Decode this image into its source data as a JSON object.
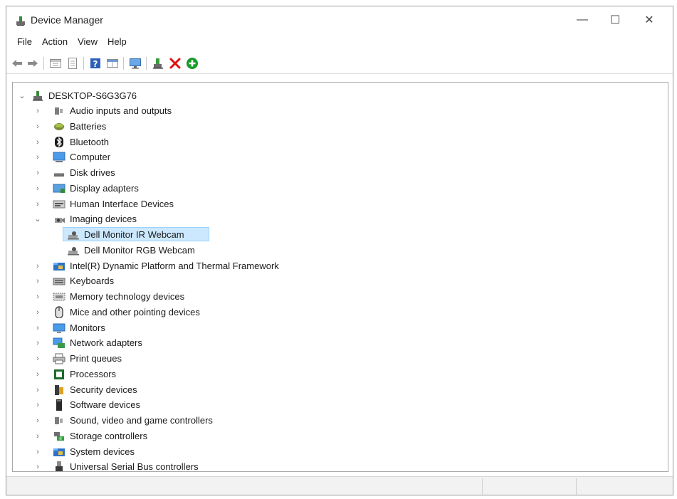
{
  "window": {
    "title": "Device Manager",
    "controls": {
      "minimize": "—",
      "maximize": "☐",
      "close": "✕"
    }
  },
  "menu": [
    "File",
    "Action",
    "View",
    "Help"
  ],
  "toolbar": [
    {
      "name": "back-arrow-icon"
    },
    {
      "name": "forward-arrow-icon"
    },
    {
      "name": "properties-pane-icon"
    },
    {
      "name": "device-sheet-icon"
    },
    {
      "name": "help-icon"
    },
    {
      "name": "view-pane-icon"
    },
    {
      "name": "monitor-scan-icon"
    },
    {
      "name": "update-driver-icon"
    },
    {
      "name": "uninstall-x-icon"
    },
    {
      "name": "add-hardware-icon"
    }
  ],
  "tree": {
    "root": "DESKTOP-S6G3G76",
    "items": [
      {
        "label": "Audio inputs and outputs",
        "icon": "speaker-icon",
        "level": 1,
        "expanded": false
      },
      {
        "label": "Batteries",
        "icon": "battery-icon",
        "level": 1,
        "expanded": false
      },
      {
        "label": "Bluetooth",
        "icon": "bluetooth-icon",
        "level": 1,
        "expanded": false
      },
      {
        "label": "Computer",
        "icon": "computer-icon",
        "level": 1,
        "expanded": false
      },
      {
        "label": "Disk drives",
        "icon": "disk-drive-icon",
        "level": 1,
        "expanded": false
      },
      {
        "label": "Display adapters",
        "icon": "display-adapter-icon",
        "level": 1,
        "expanded": false
      },
      {
        "label": "Human Interface Devices",
        "icon": "hid-icon",
        "level": 1,
        "expanded": false
      },
      {
        "label": "Imaging devices",
        "icon": "camera-icon",
        "level": 1,
        "expanded": true
      },
      {
        "label": "Dell Monitor IR Webcam",
        "icon": "webcam-icon",
        "level": 2,
        "selected": true
      },
      {
        "label": "Dell Monitor RGB Webcam",
        "icon": "webcam-icon",
        "level": 2
      },
      {
        "label": "Intel(R) Dynamic Platform and Thermal Framework",
        "icon": "folder-chip-icon",
        "level": 1,
        "expanded": false
      },
      {
        "label": "Keyboards",
        "icon": "keyboard-icon",
        "level": 1,
        "expanded": false
      },
      {
        "label": "Memory technology devices",
        "icon": "memory-icon",
        "level": 1,
        "expanded": false
      },
      {
        "label": "Mice and other pointing devices",
        "icon": "mouse-icon",
        "level": 1,
        "expanded": false
      },
      {
        "label": "Monitors",
        "icon": "monitor-icon",
        "level": 1,
        "expanded": false
      },
      {
        "label": "Network adapters",
        "icon": "network-icon",
        "level": 1,
        "expanded": false
      },
      {
        "label": "Print queues",
        "icon": "printer-icon",
        "level": 1,
        "expanded": false
      },
      {
        "label": "Processors",
        "icon": "processor-icon",
        "level": 1,
        "expanded": false
      },
      {
        "label": "Security devices",
        "icon": "security-icon",
        "level": 1,
        "expanded": false
      },
      {
        "label": "Software devices",
        "icon": "software-icon",
        "level": 1,
        "expanded": false
      },
      {
        "label": "Sound, video and game controllers",
        "icon": "speaker-icon",
        "level": 1,
        "expanded": false
      },
      {
        "label": "Storage controllers",
        "icon": "storage-icon",
        "level": 1,
        "expanded": false
      },
      {
        "label": "System devices",
        "icon": "folder-chip-icon",
        "level": 1,
        "expanded": false
      },
      {
        "label": "Universal Serial Bus controllers",
        "icon": "usb-icon",
        "level": 1,
        "expanded": false
      }
    ]
  },
  "colors": {
    "selection": "#cce8ff",
    "selection_border": "#99d1ff",
    "uninstall_red": "#e01010",
    "add_green": "#1a9a2a"
  }
}
